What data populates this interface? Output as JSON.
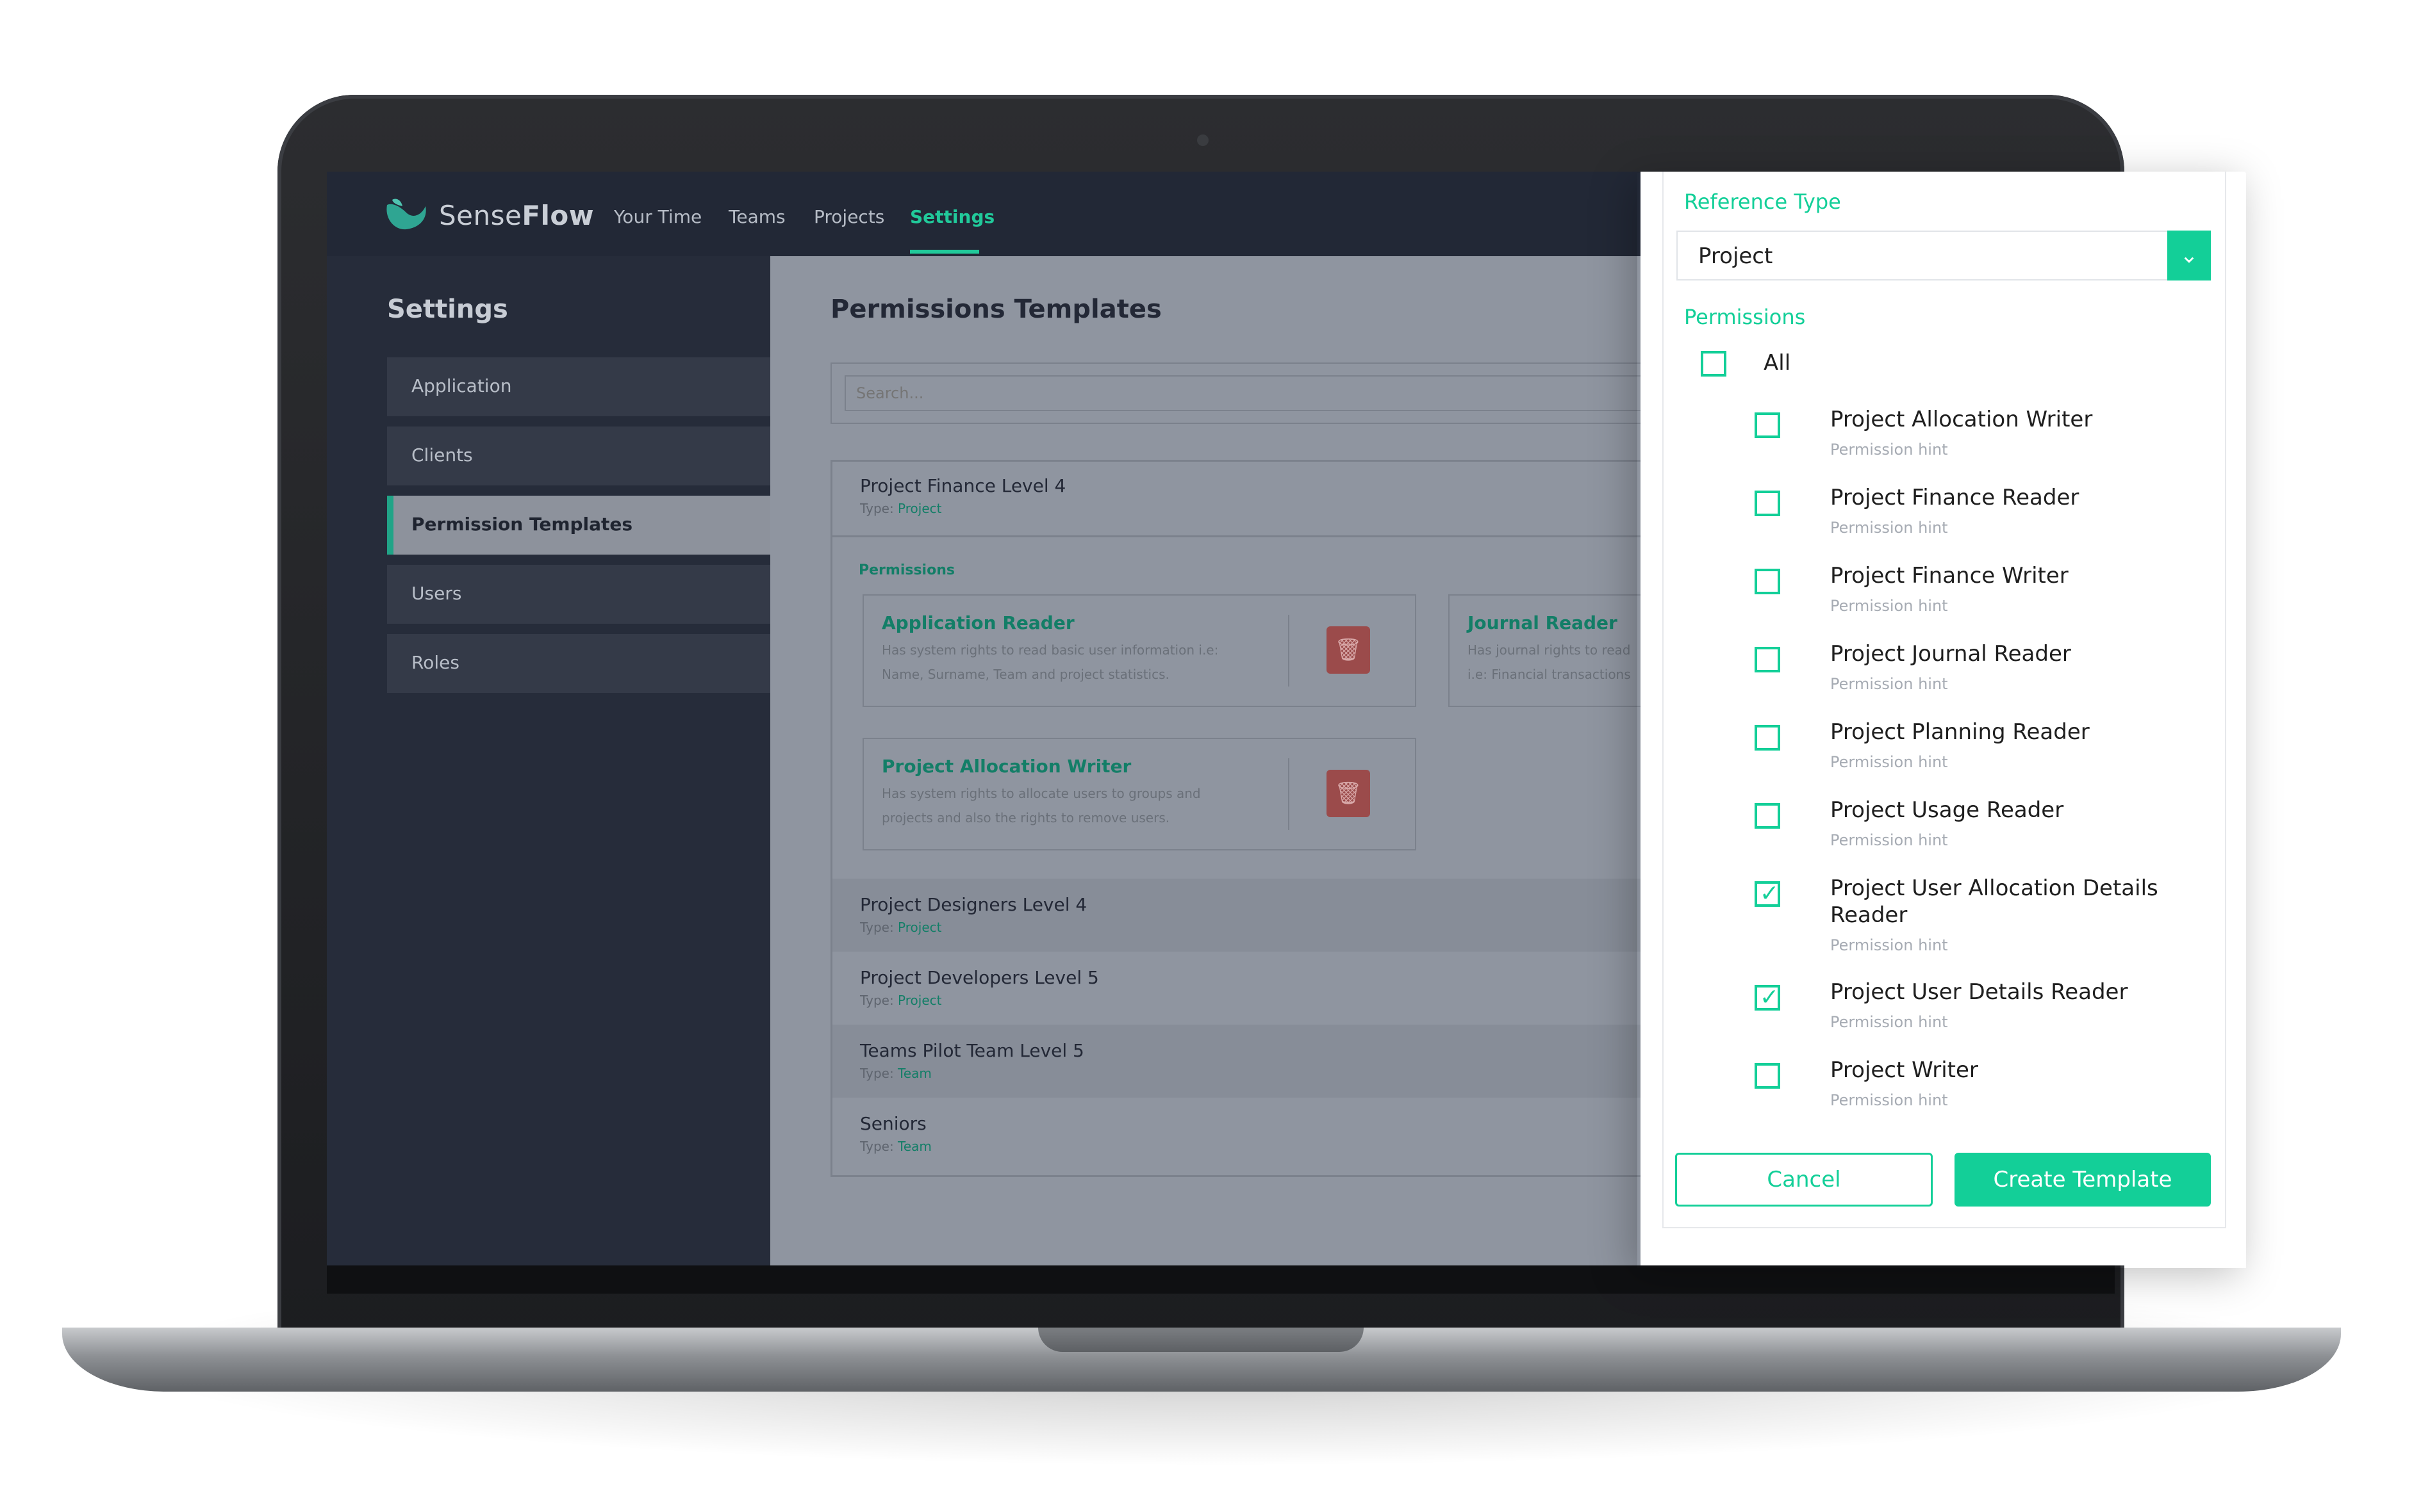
{
  "app": {
    "logo_sense": "Sense",
    "logo_flow": "Flow",
    "nav": [
      "Your Time",
      "Teams",
      "Projects",
      "Settings"
    ],
    "active_nav": "Settings",
    "accent_color": "#13cf98"
  },
  "sidebar": {
    "title": "Settings",
    "items": [
      "Application",
      "Clients",
      "Permission Templates",
      "Users",
      "Roles"
    ],
    "active_item": "Permission Templates"
  },
  "main": {
    "title": "Permissions Templates",
    "search_placeholder": "Search...",
    "type_prefix": "Type:",
    "expanded_template": {
      "name": "Project Finance Level 4",
      "type": "Project",
      "permissions_label": "Permissions",
      "permissions": [
        {
          "title": "Application Reader",
          "desc1": "Has system rights to read basic user information i.e:",
          "desc2": "Name, Surname, Team and project statistics."
        },
        {
          "title": "Journal Reader",
          "desc1": "Has journal rights to read",
          "desc2": "i.e: Financial transactions"
        },
        {
          "title": "Project Allocation Writer",
          "desc1": "Has system rights to allocate users to groups and",
          "desc2": "projects and also the rights to remove users."
        }
      ]
    },
    "templates": [
      {
        "name": "Project Designers Level 4",
        "type": "Project"
      },
      {
        "name": "Project Developers Level 5",
        "type": "Project"
      },
      {
        "name": "Teams Pilot Team Level 5",
        "type": "Team"
      },
      {
        "name": "Seniors",
        "type": "Team"
      }
    ]
  },
  "panel": {
    "reference_type_label": "Reference Type",
    "reference_type_value": "Project",
    "permissions_label": "Permissions",
    "all_label": "All",
    "all_checked": false,
    "permissions": [
      {
        "name": "Project Allocation Writer",
        "hint": "Permission hint",
        "checked": false
      },
      {
        "name": "Project Finance Reader",
        "hint": "Permission hint",
        "checked": false
      },
      {
        "name": "Project Finance Writer",
        "hint": "Permission hint",
        "checked": false
      },
      {
        "name": "Project Journal Reader",
        "hint": "Permission hint",
        "checked": false
      },
      {
        "name": "Project Planning Reader",
        "hint": "Permission hint",
        "checked": false
      },
      {
        "name": "Project Usage Reader",
        "hint": "Permission hint",
        "checked": false
      },
      {
        "name": "Project User Allocation Details Reader",
        "hint": "Permission hint",
        "checked": true
      },
      {
        "name": "Project User Details Reader",
        "hint": "Permission hint",
        "checked": true
      },
      {
        "name": "Project Writer",
        "hint": "Permission hint",
        "checked": false
      }
    ],
    "cancel_label": "Cancel",
    "create_label": "Create Template"
  }
}
